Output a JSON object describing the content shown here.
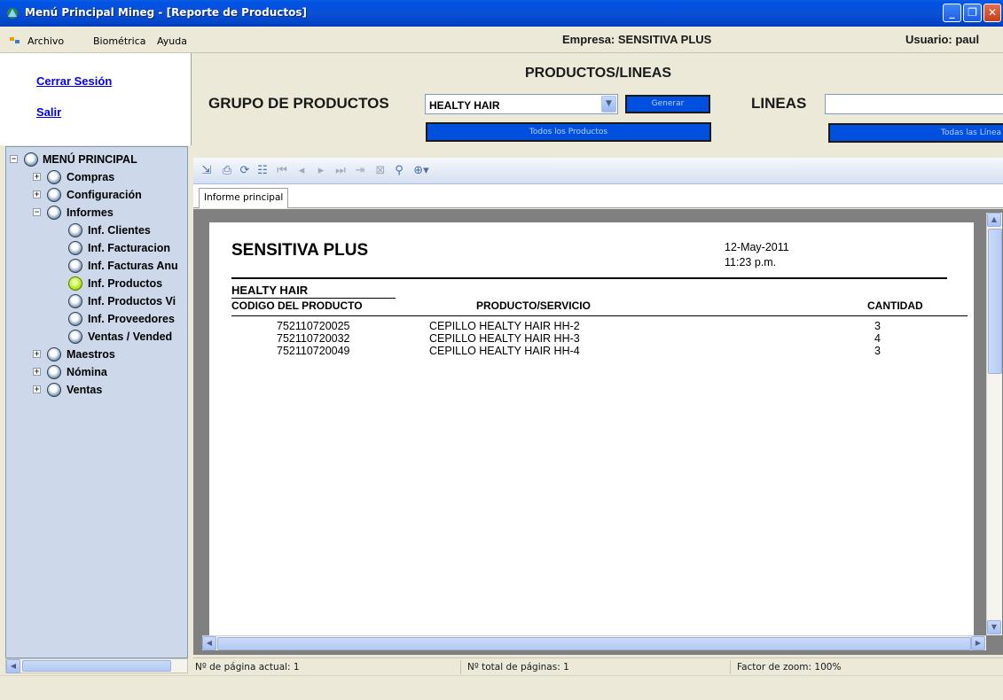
{
  "window": {
    "title": "Menú Principal Mineg - [Reporte de Productos]",
    "controls": {
      "minimize": "_",
      "restore": "❐",
      "close": "✕"
    }
  },
  "menubar": {
    "items": [
      "Archivo",
      "Biométrica",
      "Ayuda"
    ],
    "company": "Empresa: SENSITIVA PLUS",
    "user": "Usuario: paul"
  },
  "left_links": {
    "logout": "Cerrar Sesión",
    "exit": "Salir"
  },
  "tree": {
    "root": "MENÚ PRINCIPAL",
    "compras": "Compras",
    "configuracion": "Configuración",
    "informes": "Informes",
    "inf_clientes": "Inf. Clientes",
    "inf_facturacion": "Inf. Facturacion",
    "inf_facturas_anuladas": "Inf. Facturas Anu",
    "inf_productos": "Inf. Productos",
    "inf_productos_v": "Inf. Productos Vi",
    "inf_proveedores": "Inf. Proveedores",
    "ventas_vendedor": "Ventas / Vended",
    "maestros": "Maestros",
    "nomina": "Nómina",
    "ventas": "Ventas"
  },
  "filters": {
    "heading": "PRODUCTOS/LINEAS",
    "group_label": "GRUPO DE PRODUCTOS",
    "group_value": "HEALTY HAIR",
    "generate_button": "Generar",
    "lines_label": "LINEAS",
    "lines_value": "",
    "all_products_button": "Todos los Productos",
    "all_lines_button": "Todas las Línea"
  },
  "report_toolbar": {
    "tab": "Informe principal"
  },
  "report": {
    "company": "SENSITIVA PLUS",
    "date": "12-May-2011",
    "time": "11:23 p.m.",
    "group_name": "HEALTY HAIR",
    "columns": {
      "code": "CODIGO DEL PRODUCTO",
      "product": "PRODUCTO/SERVICIO",
      "quantity": "CANTIDAD"
    },
    "rows": [
      {
        "code": "752110720025",
        "product": "CEPILLO HEALTY HAIR HH-2",
        "quantity": "3"
      },
      {
        "code": "752110720032",
        "product": "CEPILLO HEALTY HAIR HH-3",
        "quantity": "4"
      },
      {
        "code": "752110720049",
        "product": "CEPILLO HEALTY HAIR HH-4",
        "quantity": "3"
      }
    ]
  },
  "status": {
    "current_page": "Nº de página actual: 1",
    "total_pages": "Nº total de páginas: 1",
    "zoom": "Factor de zoom: 100%"
  }
}
